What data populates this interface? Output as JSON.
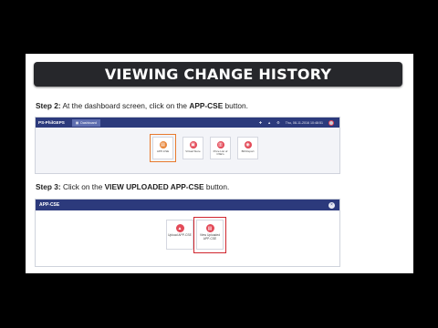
{
  "title": "VIEWING CHANGE HISTORY",
  "step2": {
    "label": "Step 2:",
    "text": " At the dashboard screen, click on the ",
    "button": "APP-CSE",
    "suffix": " button."
  },
  "step3": {
    "label": "Step 3:",
    "text": " Click on the ",
    "button": "VIEW UPLOADED APP-CSE",
    "suffix": " button."
  },
  "dashboard": {
    "brand": "PS-PhilGEPS",
    "tab_label": "Dashboard",
    "datetime": "Thu, 08-11-2016 10:48:51",
    "cards": [
      {
        "label": "APP-CSE",
        "icon": "document-icon",
        "color": "#e8863a"
      },
      {
        "label": "Virtual Store",
        "icon": "store-icon",
        "color": "#e34a58"
      },
      {
        "label": "Price List of CSE's",
        "icon": "pricelist-icon",
        "color": "#e34a58"
      },
      {
        "label": "Bill Report",
        "icon": "report-icon",
        "color": "#e34a58"
      }
    ]
  },
  "modal": {
    "title": "APP-CSE",
    "close_symbol": "×",
    "cards": [
      {
        "label": "Upload APP-CSE",
        "icon": "upload-icon"
      },
      {
        "label": "View Uploaded APP-CSE",
        "icon": "view-icon"
      }
    ]
  }
}
